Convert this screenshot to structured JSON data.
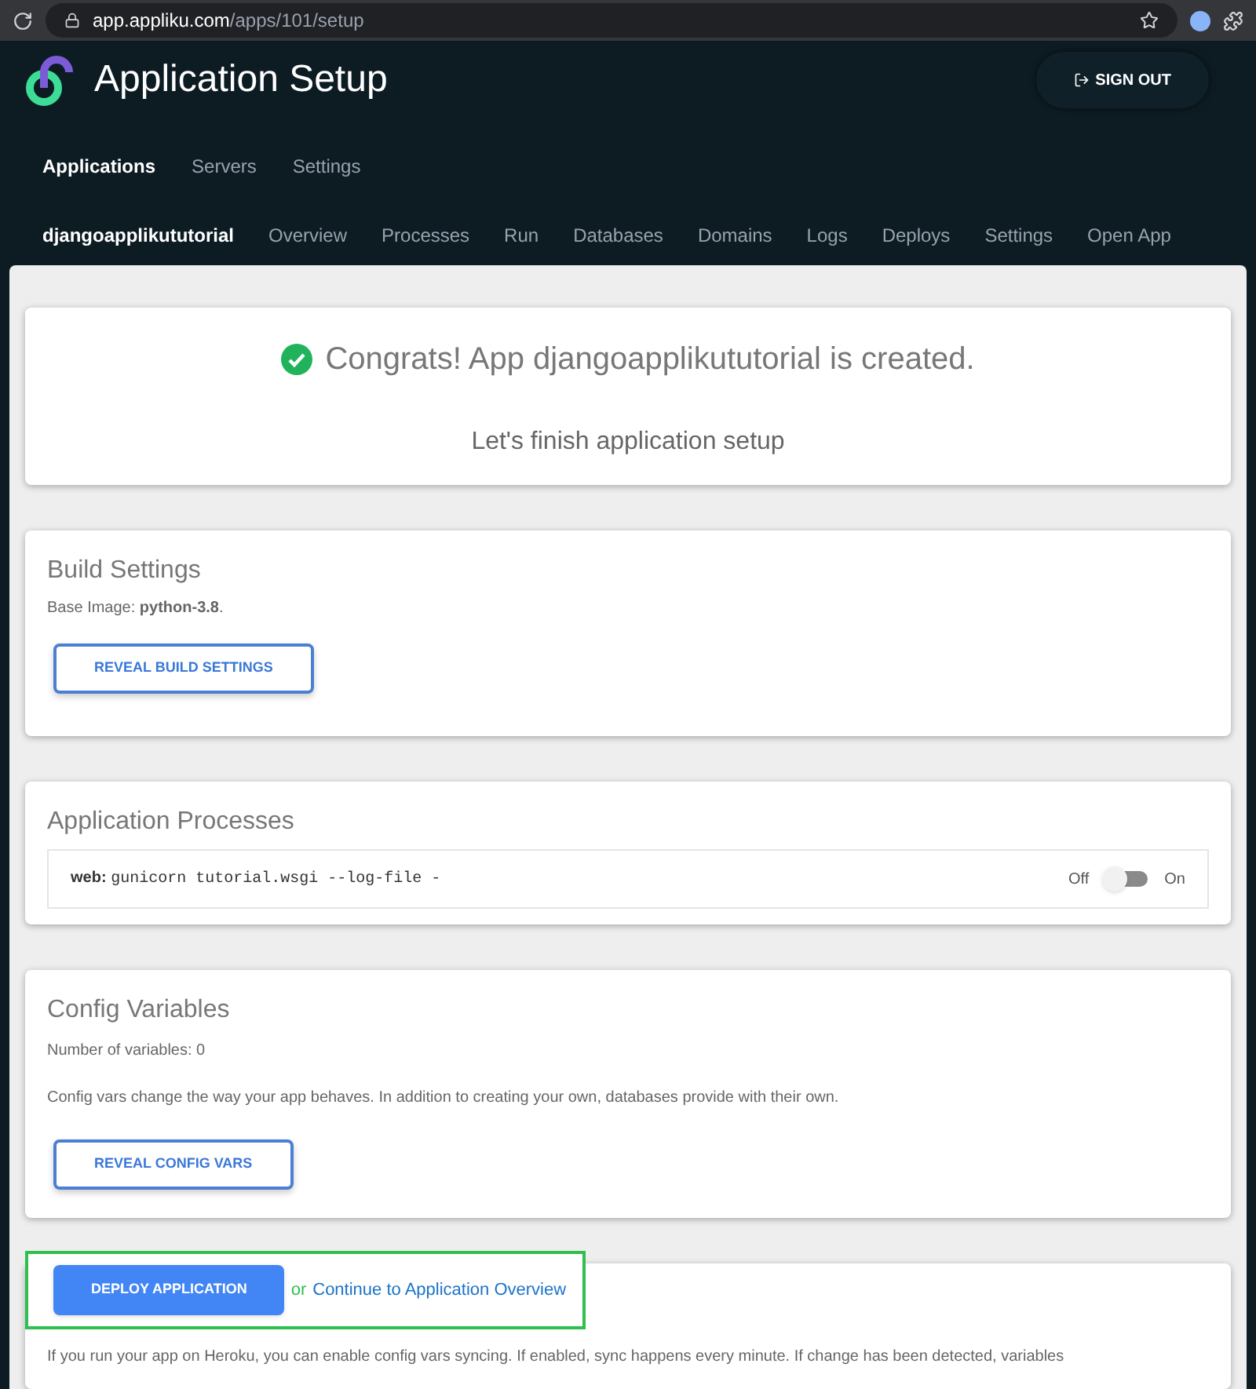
{
  "browser": {
    "url_host": "app.appliku.com",
    "url_path": "/apps/101/setup"
  },
  "header": {
    "title": "Application Setup",
    "sign_out": "SIGN OUT"
  },
  "main_nav": [
    {
      "label": "Applications",
      "selected": true
    },
    {
      "label": "Servers",
      "selected": false
    },
    {
      "label": "Settings",
      "selected": false
    }
  ],
  "app_nav": [
    {
      "label": "djangoapplikututorial",
      "selected": true
    },
    {
      "label": "Overview",
      "selected": false
    },
    {
      "label": "Processes",
      "selected": false
    },
    {
      "label": "Run",
      "selected": false
    },
    {
      "label": "Databases",
      "selected": false
    },
    {
      "label": "Domains",
      "selected": false
    },
    {
      "label": "Logs",
      "selected": false
    },
    {
      "label": "Deploys",
      "selected": false
    },
    {
      "label": "Settings",
      "selected": false
    },
    {
      "label": "Open App",
      "selected": false
    }
  ],
  "congrats": {
    "title": "Congrats! App djangoapplikututorial is created.",
    "subtitle": "Let's finish application setup"
  },
  "build_settings": {
    "title": "Build Settings",
    "base_image": "Base Image: **python-3.8**.",
    "button": "REVEAL BUILD SETTINGS"
  },
  "processes": {
    "title": "Application Processes",
    "items": [
      {
        "name": "web:",
        "command": "gunicorn tutorial.wsgi --log-file -",
        "off_label": "Off",
        "on_label": "On",
        "on": false
      }
    ]
  },
  "config_variables": {
    "title": "Config Variables",
    "count": "Number of variables: 0",
    "description": "Config vars change the way your app behaves. In addition to creating your own, databases provide with their own.",
    "button": "REVEAL CONFIG VARS"
  },
  "deploy": {
    "button": "DEPLOY APPLICATION",
    "or": "or",
    "link": "Continue to Application Overview"
  },
  "heroku_sync": {
    "text": "If you run your app on Heroku, you can enable config vars syncing. If enabled, sync happens every minute. If change has been detected, variables"
  }
}
